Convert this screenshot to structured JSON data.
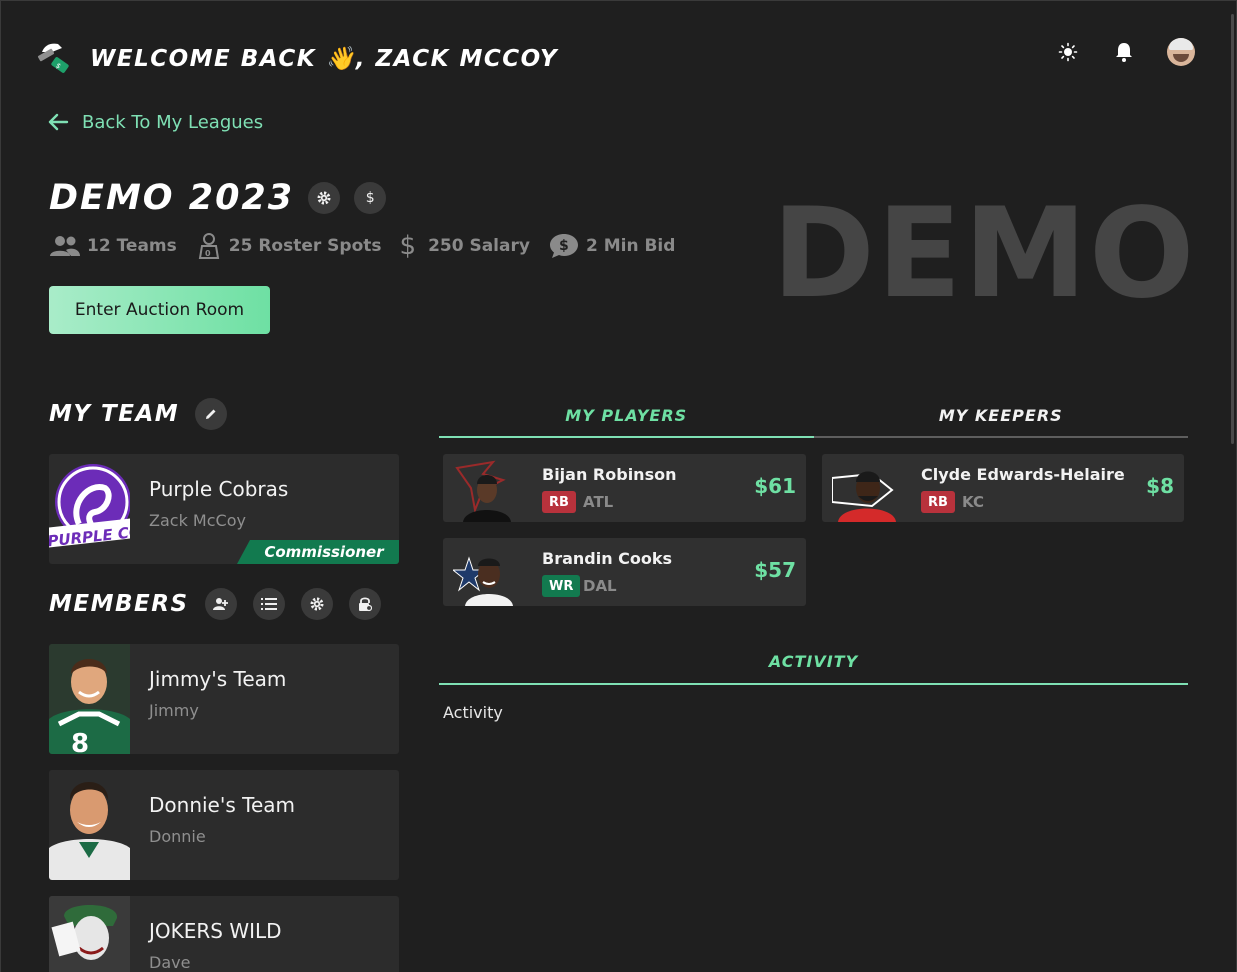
{
  "header": {
    "welcome": "WELCOME BACK 👋, ZACK MCCOY",
    "icons": [
      "theme-toggle-icon",
      "bell-icon",
      "user-avatar"
    ]
  },
  "nav": {
    "back_label": "Back To My Leagues"
  },
  "league": {
    "name": "DEMO 2023",
    "watermark": "DEMO",
    "stats": {
      "teams": "12 Teams",
      "roster": "25 Roster Spots",
      "salary": "250 Salary",
      "min_bid": "2 Min Bid"
    },
    "enter_button": "Enter Auction Room"
  },
  "my_team": {
    "heading": "MY TEAM",
    "team_name": "Purple Cobras",
    "owner": "Zack McCoy",
    "badge": "Commissioner",
    "logo_text": "PURPLE COBRA"
  },
  "members": {
    "heading": "MEMBERS",
    "list": [
      {
        "team": "Jimmy's Team",
        "owner": "Jimmy"
      },
      {
        "team": "Donnie's Team",
        "owner": "Donnie"
      },
      {
        "team": "JOKERS WILD",
        "owner": "Dave"
      }
    ]
  },
  "tabs": {
    "players": "MY PLAYERS",
    "keepers": "MY KEEPERS",
    "active": "players"
  },
  "players": [
    {
      "name": "Bijan Robinson",
      "pos": "RB",
      "team": "ATL",
      "price": "$61"
    },
    {
      "name": "Brandin Cooks",
      "pos": "WR",
      "team": "DAL",
      "price": "$57"
    }
  ],
  "keepers": [
    {
      "name": "Clyde Edwards-Helaire",
      "pos": "RB",
      "team": "KC",
      "price": "$8"
    }
  ],
  "activity": {
    "heading": "ACTIVITY",
    "text": "Activity"
  },
  "colors": {
    "accent": "#6ee0a3",
    "background": "#1f1f1f",
    "card": "#2c2c2c",
    "rb": "#b8323c",
    "wr": "#127a4f"
  }
}
